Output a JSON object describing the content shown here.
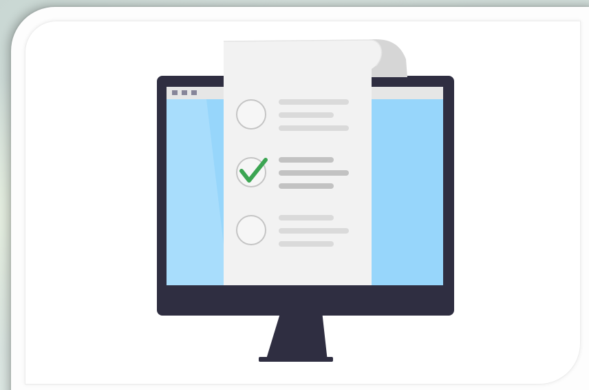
{
  "colors": {
    "monitor_frame": "#2f2e41",
    "screen": "#97d6fb",
    "screen_highlight": "#b9e4fd",
    "browser_bar": "#e6e6e6",
    "browser_dots": "#868599",
    "paper": "#f2f2f2",
    "paper_curl": "#d6d6d6",
    "circle_stroke": "#c4c4c4",
    "line_light": "#dadada",
    "line_dark": "#c2c2c2",
    "checkmark": "#3ba552"
  },
  "checklist": [
    {
      "checked": false
    },
    {
      "checked": true
    },
    {
      "checked": false
    }
  ]
}
